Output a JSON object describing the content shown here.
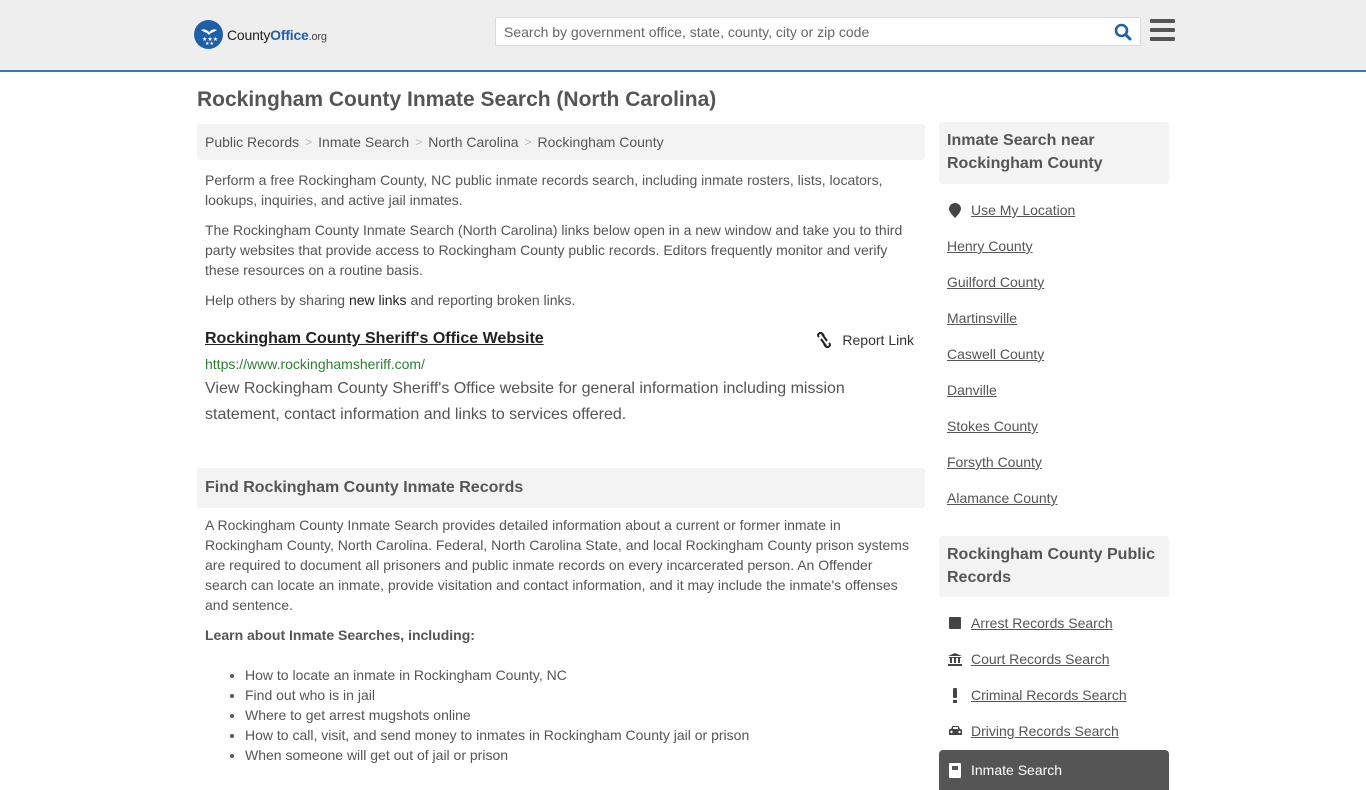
{
  "header": {
    "logo": {
      "text_county": "County",
      "text_office": "Office",
      "text_org": ".org",
      "icon": "eagle-stars-badge-icon"
    },
    "search": {
      "placeholder": "Search by government office, state, county, city or zip code",
      "value": "",
      "icon": "search-icon"
    },
    "menu_icon": "hamburger-menu-icon"
  },
  "colors": {
    "accent": "#337ab7",
    "brand_blue": "#1f5fa6",
    "url_green": "#2e7d32",
    "panel_bg": "#f3f3f3",
    "active_bg": "#555555"
  },
  "page": {
    "title": "Rockingham County Inmate Search (North Carolina)",
    "breadcrumb": [
      "Public Records",
      "Inmate Search",
      "North Carolina",
      "Rockingham County"
    ],
    "breadcrumb_sep": ">",
    "intro": "Perform a free Rockingham County, NC public inmate records search, including inmate rosters, lists, locators, lookups, inquiries, and active jail inmates.",
    "disclaimer": "The Rockingham County Inmate Search (North Carolina) links below open in a new window and take you to third party websites that provide access to Rockingham County public records. Editors frequently monitor and verify these resources on a routine basis.",
    "help": {
      "before": "Help others by sharing ",
      "link": "new links",
      "after": " and reporting broken links."
    }
  },
  "results": [
    {
      "title": "Rockingham County Sheriff's Office Website",
      "url": "https://www.rockinghamsheriff.com/",
      "description": "View Rockingham County Sheriff's Office website for general information including mission statement, contact information and links to services offered.",
      "report_label": "Report Link",
      "report_icon": "broken-link-icon"
    }
  ],
  "find_section": {
    "heading": "Find Rockingham County Inmate Records",
    "body": "A Rockingham County Inmate Search provides detailed information about a current or former inmate in Rockingham County, North Carolina. Federal, North Carolina State, and local Rockingham County prison systems are required to document all prisoners and public inmate records on every incarcerated person. An Offender search can locate an inmate, provide visitation and contact information, and it may include the inmate's offenses and sentence.",
    "learn_heading": "Learn about Inmate Searches, including:",
    "learn_items": [
      "How to locate an inmate in Rockingham County, NC",
      "Find out who is in jail",
      "Where to get arrest mugshots online",
      "How to call, visit, and send money to inmates in Rockingham County jail or prison",
      "When someone will get out of jail or prison"
    ]
  },
  "sidebar": {
    "near_heading": "Inmate Search near Rockingham County",
    "use_location": {
      "label": "Use My Location",
      "icon": "map-marker-icon"
    },
    "near_items": [
      "Henry County",
      "Guilford County",
      "Martinsville",
      "Caswell County",
      "Danville",
      "Stokes County",
      "Forsyth County",
      "Alamance County"
    ],
    "records_heading": "Rockingham County Public Records",
    "records_items": [
      {
        "label": "Arrest Records Search",
        "icon": "square-icon"
      },
      {
        "label": "Court Records Search",
        "icon": "courthouse-icon"
      },
      {
        "label": "Criminal Records Search",
        "icon": "exclamation-icon"
      },
      {
        "label": "Driving Records Search",
        "icon": "car-icon"
      }
    ],
    "active_item": {
      "label": "Inmate Search",
      "icon": "jail-door-icon"
    }
  }
}
